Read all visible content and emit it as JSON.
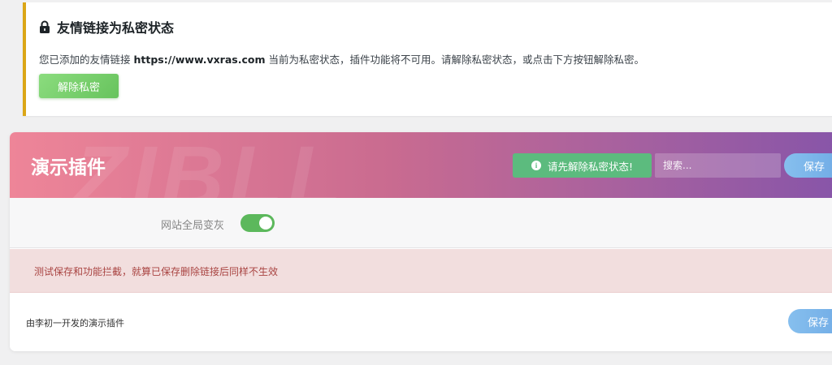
{
  "notice": {
    "title": "友情链接为私密状态",
    "text_before": "您已添加的友情链接 ",
    "link_url": "https://www.vxras.com",
    "text_after": " 当前为私密状态，插件功能将不可用。请解除私密状态，或点击下方按钮解除私密。",
    "button_label": "解除私密",
    "icon": "lock-icon",
    "accent_color": "#dba617"
  },
  "panel": {
    "title": "演示插件",
    "watermark": "ZIBLL",
    "warning_button_label": "请先解除私密状态!",
    "warning_icon": "info-icon",
    "search_placeholder": "搜索...",
    "save_label": "保存",
    "header_gradient": [
      "#ee8598",
      "#c96b90",
      "#a460a0",
      "#8554a9"
    ]
  },
  "settings": {
    "gray_site_label": "网站全局变灰",
    "gray_site_enabled": true,
    "toggle_color": "#5cb85c"
  },
  "alert": {
    "text": "测试保存和功能拦截，就算已保存删除链接后同样不生效",
    "color": "#a94442"
  },
  "footer": {
    "text": "由李初一开发的演示插件",
    "save_label": "保存"
  }
}
